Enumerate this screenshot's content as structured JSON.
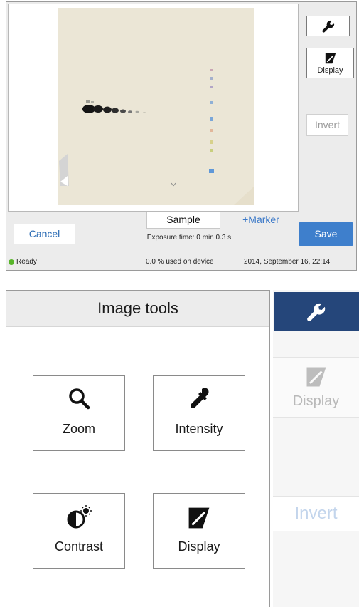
{
  "camera_screen": {
    "buttons": {
      "tools_icon": "wrench-icon",
      "display_label": "Display",
      "invert_label": "Invert",
      "cancel_label": "Cancel",
      "save_label": "Save"
    },
    "tabs": {
      "sample_label": "Sample",
      "marker_label": "+Marker"
    },
    "exposure_text": "Exposure time: 0 min 0.3 s",
    "status": {
      "state": "Ready",
      "state_color": "#58b52a",
      "storage": "0.0 % used on device",
      "datetime": "2014, September 16, 22:14"
    }
  },
  "image_tools_panel": {
    "title": "Image tools",
    "tiles": [
      {
        "label": "Zoom",
        "icon": "magnifier-icon"
      },
      {
        "label": "Intensity",
        "icon": "eyedropper-icon"
      },
      {
        "label": "Contrast",
        "icon": "contrast-icon"
      },
      {
        "label": "Display",
        "icon": "display-icon"
      }
    ],
    "side": {
      "wrench_icon": "wrench-icon",
      "display_label": "Display",
      "invert_label": "Invert"
    }
  },
  "colors": {
    "accent": "#3e7fcc",
    "active_nav": "#25467a",
    "marker_link": "#3a78c8"
  }
}
